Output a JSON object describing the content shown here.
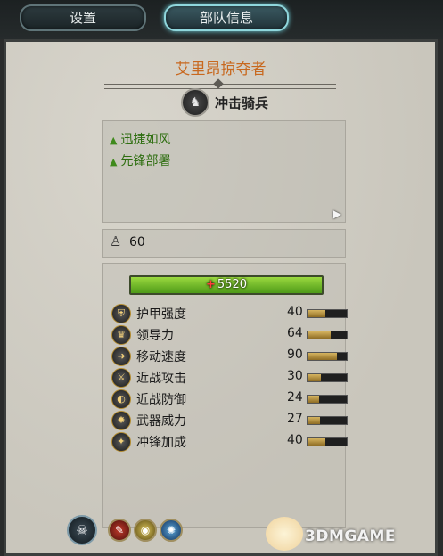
{
  "tabs": [
    {
      "label": "设置"
    },
    {
      "label": "部队信息"
    }
  ],
  "unit": {
    "name": "艾里昂掠夺者",
    "class_label": "冲击骑兵",
    "class_icon": "cavalry-icon"
  },
  "traits": [
    {
      "label": "迅捷如风",
      "icon": "green-triangle-icon"
    },
    {
      "label": "先锋部署",
      "icon": "green-triangle-icon"
    }
  ],
  "men_count": "60",
  "health": {
    "value": "5520",
    "fill_fraction": 1.0
  },
  "stats": [
    {
      "name": "护甲强度",
      "value": "40",
      "icon": "armor-icon",
      "fill": 0.45
    },
    {
      "name": "领导力",
      "value": "64",
      "icon": "leadership-icon",
      "fill": 0.6
    },
    {
      "name": "移动速度",
      "value": "90",
      "icon": "speed-icon",
      "fill": 0.75
    },
    {
      "name": "近战攻击",
      "value": "30",
      "icon": "melee-attack-icon",
      "fill": 0.35
    },
    {
      "name": "近战防御",
      "value": "24",
      "icon": "melee-defence-icon",
      "fill": 0.3
    },
    {
      "name": "武器威力",
      "value": "27",
      "icon": "weapon-strength-icon",
      "fill": 0.32
    },
    {
      "name": "冲锋加成",
      "value": "40",
      "icon": "charge-bonus-icon",
      "fill": 0.45
    }
  ],
  "abilities": [
    "skull-ability-icon",
    "fire-ability-icon",
    "eye-ability-icon",
    "blue-ability-icon"
  ],
  "watermark": {
    "text": "3DMGAME"
  },
  "colors": {
    "title": "#c8681e",
    "trait": "#2e6e10",
    "health_bar": "#6fbf2a",
    "active_tab_glow": "#6fd0da"
  }
}
